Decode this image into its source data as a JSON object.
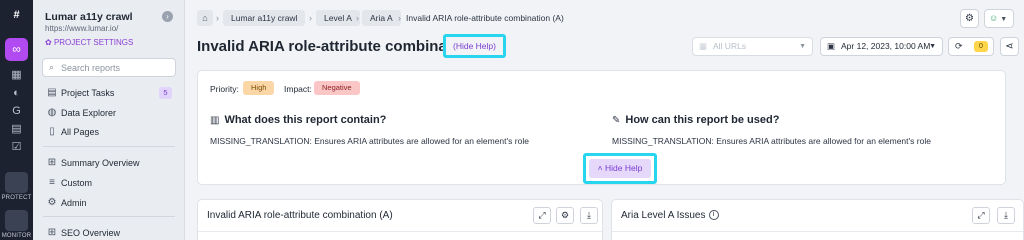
{
  "rail": {
    "logo_icon": "hash-icon",
    "active_icon": "link-icon",
    "items": [
      "grid-icon",
      "globe-icon",
      "gauge-icon",
      "clipboard-icon",
      "check-square-icon"
    ],
    "labels": {
      "protect": "PROTECT",
      "monitor": "MONITOR"
    }
  },
  "sidebar": {
    "project_name": "Lumar a11y crawl",
    "project_url": "https://www.lumar.io/",
    "collapse_icon": "›",
    "settings_label": "PROJECT SETTINGS",
    "search_placeholder": "Search reports",
    "items": [
      {
        "label": "Project Tasks",
        "count": "5",
        "icon": "clipboard-icon"
      },
      {
        "label": "Data Explorer",
        "icon": "magnifier-icon"
      },
      {
        "label": "All Pages",
        "icon": "document-icon"
      },
      {
        "label": "Summary Overview",
        "icon": "grid-icon"
      },
      {
        "label": "Custom",
        "icon": "sliders-icon"
      },
      {
        "label": "Admin",
        "icon": "gear-icon"
      },
      {
        "label": "SEO Overview",
        "icon": "grid-icon"
      }
    ]
  },
  "breadcrumb": {
    "items": [
      "Lumar a11y crawl",
      "Level A",
      "Aria A"
    ],
    "current": "Invalid ARIA role-attribute combination (A)"
  },
  "header": {
    "title": "Invalid ARIA role-attribute combination (A)",
    "hide_help_link": "(Hide Help)",
    "url_filter": "All URLs",
    "date": "Apr 12, 2023, 10:00 AM",
    "sync_count": "0"
  },
  "help": {
    "priority_label": "Priority:",
    "priority_value": "High",
    "impact_label": "Impact:",
    "impact_value": "Negative",
    "what_title": "What does this report contain?",
    "what_body": "MISSING_TRANSLATION: Ensures ARIA attributes are allowed for an element's role",
    "how_title": "How can this report be used?",
    "how_body": "MISSING_TRANSLATION: Ensures ARIA attributes are allowed for an element's role",
    "hide_button": "Hide Help"
  },
  "panels": [
    {
      "title": "Invalid ARIA role-attribute combination (A)"
    },
    {
      "title": "Aria Level A Issues"
    }
  ],
  "colors": {
    "accent": "#b14af0",
    "highlight": "#27d6ee",
    "priority_high": "#fbd7a7",
    "impact_negative": "#fbc6c6"
  }
}
